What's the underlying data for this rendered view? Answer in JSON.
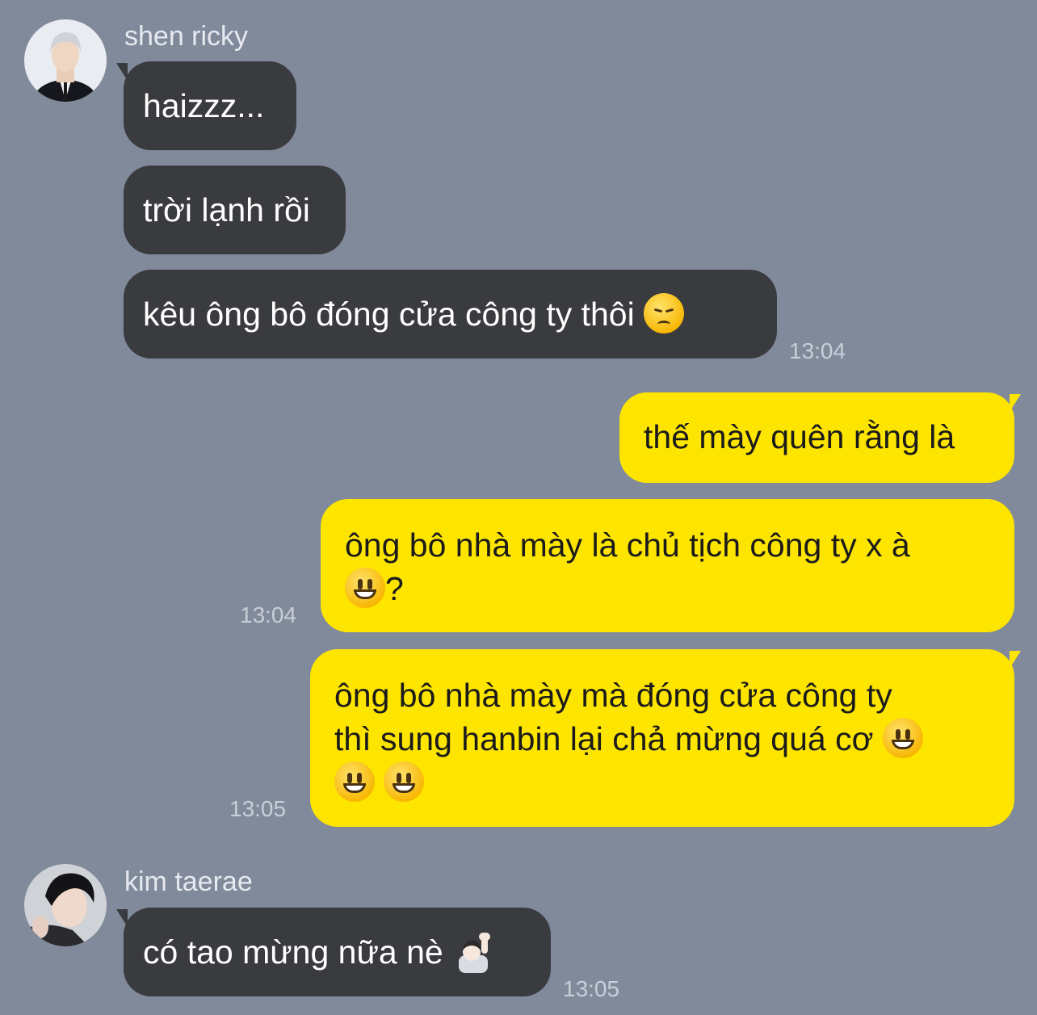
{
  "messages": {
    "group1": {
      "sender": "shen ricky",
      "m1": "haizzz...",
      "m2": "trời lạnh rồi",
      "m3": "kêu ông bô đóng cửa công ty thôi",
      "time": "13:04",
      "emoji": "pensive-face-emoji"
    },
    "outgoing": {
      "m1": "thế mày quên rằng là",
      "m2_text": "ông bô nhà mày là chủ tịch công ty x à",
      "m2_tail": "?",
      "m2_time": "13:04",
      "m3_line1": "ông bô nhà mày mà đóng cửa công ty",
      "m3_line2": "thì sung hanbin lại chả mừng quá cơ",
      "m3_time": "13:05",
      "emoji": "grinning-face-emoji"
    },
    "group2": {
      "sender": "kim taerae",
      "m1": "có tao mừng nữa nè",
      "time": "13:05",
      "emoji": "raising-hand-emoji"
    }
  },
  "colors": {
    "background": "#808a9b",
    "incoming_bubble": "#3a3b3f",
    "outgoing_bubble": "#fee500"
  }
}
